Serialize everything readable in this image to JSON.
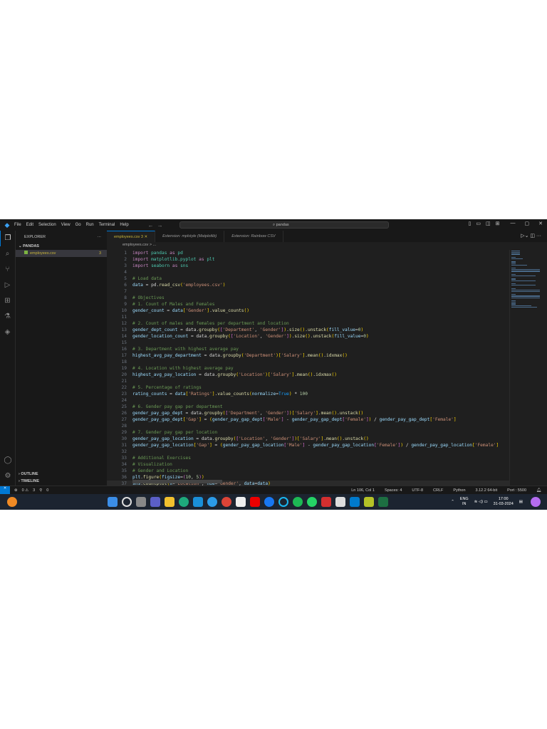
{
  "menu": [
    "File",
    "Edit",
    "Selection",
    "View",
    "Go",
    "Run",
    "Terminal",
    "Help"
  ],
  "search": "pandas",
  "sidebar": {
    "title": "EXPLORER",
    "folder": "PANDAS",
    "file": "employees.csv",
    "file_badge": "3",
    "outline": "OUTLINE",
    "timeline": "TIMELINE"
  },
  "tabs": [
    {
      "label": "employees.csv 3 ✕"
    },
    {
      "label": "Extension: mplstyle (Matplotlib)"
    },
    {
      "label": "Extension: Rainbow CSV"
    }
  ],
  "breadcrumb": "employees.csv > ...",
  "code": [
    [
      [
        "k",
        "import "
      ],
      [
        "m",
        "pandas"
      ],
      [
        "k",
        " as "
      ],
      [
        "m",
        "pd"
      ]
    ],
    [
      [
        "k",
        "import "
      ],
      [
        "m",
        "matplotlib.pyplot"
      ],
      [
        "k",
        " as "
      ],
      [
        "m",
        "plt"
      ]
    ],
    [
      [
        "k",
        "import "
      ],
      [
        "m",
        "seaborn"
      ],
      [
        "k",
        " as "
      ],
      [
        "m",
        "sns"
      ]
    ],
    [],
    [
      [
        "c",
        "# Load data"
      ]
    ],
    [
      [
        "v",
        "data"
      ],
      [
        "p",
        " = pd."
      ],
      [
        "f",
        "read_csv"
      ],
      [
        "b1",
        "("
      ],
      [
        "s",
        "'employees.csv'"
      ],
      [
        "b1",
        ")"
      ]
    ],
    [],
    [
      [
        "c",
        "# Objectives"
      ]
    ],
    [
      [
        "c",
        "# 1. Count of Males and Females"
      ]
    ],
    [
      [
        "v",
        "gender_count"
      ],
      [
        "p",
        " = "
      ],
      [
        "v",
        "data"
      ],
      [
        "b1",
        "["
      ],
      [
        "s",
        "'Gender'"
      ],
      [
        "b1",
        "]"
      ],
      [
        "p",
        "."
      ],
      [
        "f",
        "value_counts"
      ],
      [
        "b1",
        "()"
      ]
    ],
    [],
    [
      [
        "c",
        "# 2. Count of males and females per department and location"
      ]
    ],
    [
      [
        "v",
        "gender_dept_count"
      ],
      [
        "p",
        " = data."
      ],
      [
        "f",
        "groupby"
      ],
      [
        "b1",
        "("
      ],
      [
        "b2",
        "["
      ],
      [
        "s",
        "'Department'"
      ],
      [
        "p",
        ", "
      ],
      [
        "s",
        "'Gender'"
      ],
      [
        "b2",
        "]"
      ],
      [
        "b1",
        ")"
      ],
      [
        "p",
        "."
      ],
      [
        "f",
        "size"
      ],
      [
        "b1",
        "()"
      ],
      [
        "p",
        "."
      ],
      [
        "f",
        "unstack"
      ],
      [
        "b1",
        "("
      ],
      [
        "v",
        "fill_value"
      ],
      [
        "p",
        "="
      ],
      [
        "n",
        "0"
      ],
      [
        "b1",
        ")"
      ]
    ],
    [
      [
        "v",
        "gender_location_count"
      ],
      [
        "p",
        " = data."
      ],
      [
        "f",
        "groupby"
      ],
      [
        "b1",
        "("
      ],
      [
        "b2",
        "["
      ],
      [
        "s",
        "'Location'"
      ],
      [
        "p",
        ", "
      ],
      [
        "s",
        "'Gender'"
      ],
      [
        "b2",
        "]"
      ],
      [
        "b1",
        ")"
      ],
      [
        "p",
        "."
      ],
      [
        "f",
        "size"
      ],
      [
        "b1",
        "()"
      ],
      [
        "p",
        "."
      ],
      [
        "f",
        "unstack"
      ],
      [
        "b1",
        "("
      ],
      [
        "v",
        "fill_value"
      ],
      [
        "p",
        "="
      ],
      [
        "n",
        "0"
      ],
      [
        "b1",
        ")"
      ]
    ],
    [],
    [
      [
        "c",
        "# 3. Department with highest average pay"
      ]
    ],
    [
      [
        "v",
        "highest_avg_pay_department"
      ],
      [
        "p",
        " = data."
      ],
      [
        "f",
        "groupby"
      ],
      [
        "b1",
        "("
      ],
      [
        "s",
        "'Department'"
      ],
      [
        "b1",
        ")"
      ],
      [
        "b1",
        "["
      ],
      [
        "s",
        "'Salary'"
      ],
      [
        "b1",
        "]"
      ],
      [
        "p",
        "."
      ],
      [
        "f",
        "mean"
      ],
      [
        "b1",
        "()"
      ],
      [
        "p",
        "."
      ],
      [
        "f",
        "idxmax"
      ],
      [
        "b1",
        "()"
      ]
    ],
    [],
    [
      [
        "c",
        "# 4. Location with highest average pay"
      ]
    ],
    [
      [
        "v",
        "highest_avg_pay_location"
      ],
      [
        "p",
        " = data."
      ],
      [
        "f",
        "groupby"
      ],
      [
        "b1",
        "("
      ],
      [
        "s",
        "'Location'"
      ],
      [
        "b1",
        ")"
      ],
      [
        "b1",
        "["
      ],
      [
        "s",
        "'Salary'"
      ],
      [
        "b1",
        "]"
      ],
      [
        "p",
        "."
      ],
      [
        "f",
        "mean"
      ],
      [
        "b1",
        "()"
      ],
      [
        "p",
        "."
      ],
      [
        "f",
        "idxmax"
      ],
      [
        "b1",
        "()"
      ]
    ],
    [],
    [
      [
        "c",
        "# 5. Percentage of ratings"
      ]
    ],
    [
      [
        "v",
        "rating_counts"
      ],
      [
        "p",
        " = "
      ],
      [
        "v",
        "data"
      ],
      [
        "b1",
        "["
      ],
      [
        "s",
        "'Ratings'"
      ],
      [
        "b1",
        "]"
      ],
      [
        "p",
        "."
      ],
      [
        "f",
        "value_counts"
      ],
      [
        "b1",
        "("
      ],
      [
        "v",
        "normalize"
      ],
      [
        "p",
        "="
      ],
      [
        "b3",
        "True"
      ],
      [
        "b1",
        ")"
      ],
      [
        "p",
        " * "
      ],
      [
        "n",
        "100"
      ]
    ],
    [],
    [
      [
        "c",
        "# 6. Gender pay gap per department"
      ]
    ],
    [
      [
        "v",
        "gender_pay_gap_dept"
      ],
      [
        "p",
        " = data."
      ],
      [
        "f",
        "groupby"
      ],
      [
        "b1",
        "("
      ],
      [
        "b2",
        "["
      ],
      [
        "s",
        "'Department'"
      ],
      [
        "p",
        ", "
      ],
      [
        "s",
        "'Gender'"
      ],
      [
        "b2",
        "]"
      ],
      [
        "b1",
        ")"
      ],
      [
        "b1",
        "["
      ],
      [
        "s",
        "'Salary'"
      ],
      [
        "b1",
        "]"
      ],
      [
        "p",
        "."
      ],
      [
        "f",
        "mean"
      ],
      [
        "b1",
        "()"
      ],
      [
        "p",
        "."
      ],
      [
        "f",
        "unstack"
      ],
      [
        "b1",
        "()"
      ]
    ],
    [
      [
        "v",
        "gender_pay_gap_dept"
      ],
      [
        "b1",
        "["
      ],
      [
        "s",
        "'Gap'"
      ],
      [
        "b1",
        "]"
      ],
      [
        "p",
        " = "
      ],
      [
        "b1",
        "("
      ],
      [
        "v",
        "gender_pay_gap_dept"
      ],
      [
        "b2",
        "["
      ],
      [
        "s",
        "'Male'"
      ],
      [
        "b2",
        "]"
      ],
      [
        "p",
        " - "
      ],
      [
        "v",
        "gender_pay_gap_dept"
      ],
      [
        "b2",
        "["
      ],
      [
        "s",
        "'Female'"
      ],
      [
        "b2",
        "]"
      ],
      [
        "b1",
        ")"
      ],
      [
        "p",
        " / "
      ],
      [
        "v",
        "gender_pay_gap_dept"
      ],
      [
        "b1",
        "["
      ],
      [
        "s",
        "'Female'"
      ],
      [
        "b1",
        "]"
      ]
    ],
    [],
    [
      [
        "c",
        "# 7. Gender pay gap per location"
      ]
    ],
    [
      [
        "v",
        "gender_pay_gap_location"
      ],
      [
        "p",
        " = data."
      ],
      [
        "f",
        "groupby"
      ],
      [
        "b1",
        "("
      ],
      [
        "b2",
        "["
      ],
      [
        "s",
        "'Location'"
      ],
      [
        "p",
        ", "
      ],
      [
        "s",
        "'Gender'"
      ],
      [
        "b2",
        "]"
      ],
      [
        "b1",
        ")"
      ],
      [
        "b1",
        "["
      ],
      [
        "s",
        "'Salary'"
      ],
      [
        "b1",
        "]"
      ],
      [
        "p",
        "."
      ],
      [
        "f",
        "mean"
      ],
      [
        "b1",
        "()"
      ],
      [
        "p",
        "."
      ],
      [
        "f",
        "unstack"
      ],
      [
        "b1",
        "()"
      ]
    ],
    [
      [
        "v",
        "gender_pay_gap_location"
      ],
      [
        "b1",
        "["
      ],
      [
        "s",
        "'Gap'"
      ],
      [
        "b1",
        "]"
      ],
      [
        "p",
        " = "
      ],
      [
        "b1",
        "("
      ],
      [
        "v",
        "gender_pay_gap_location"
      ],
      [
        "b2",
        "["
      ],
      [
        "s",
        "'Male'"
      ],
      [
        "b2",
        "]"
      ],
      [
        "p",
        " - "
      ],
      [
        "v",
        "gender_pay_gap_location"
      ],
      [
        "b2",
        "["
      ],
      [
        "s",
        "'Female'"
      ],
      [
        "b2",
        "]"
      ],
      [
        "b1",
        ")"
      ],
      [
        "p",
        " / "
      ],
      [
        "v",
        "gender_pay_gap_location"
      ],
      [
        "b1",
        "["
      ],
      [
        "s",
        "'Female'"
      ],
      [
        "b1",
        "]"
      ]
    ],
    [],
    [
      [
        "c",
        "# Additional Exercises"
      ]
    ],
    [
      [
        "c",
        "# Visualization"
      ]
    ],
    [
      [
        "c",
        "# Gender and Location"
      ]
    ],
    [
      [
        "v",
        "plt"
      ],
      [
        "p",
        "."
      ],
      [
        "f",
        "figure"
      ],
      [
        "b1",
        "("
      ],
      [
        "v",
        "figsize"
      ],
      [
        "p",
        "="
      ],
      [
        "b2",
        "("
      ],
      [
        "n",
        "10"
      ],
      [
        "p",
        ", "
      ],
      [
        "n",
        "5"
      ],
      [
        "b2",
        ")"
      ],
      [
        "b1",
        ")"
      ]
    ],
    [
      [
        "v",
        "sns"
      ],
      [
        "p",
        "."
      ],
      [
        "f",
        "countplot"
      ],
      [
        "b1",
        "("
      ],
      [
        "v",
        "x"
      ],
      [
        "p",
        "="
      ],
      [
        "s",
        "'Location'"
      ],
      [
        "p",
        ", "
      ],
      [
        "v",
        "hue"
      ],
      [
        "p",
        "="
      ],
      [
        "s",
        "'Gender'"
      ],
      [
        "p",
        ", "
      ],
      [
        "v",
        "data"
      ],
      [
        "p",
        "="
      ],
      [
        "v",
        "data"
      ],
      [
        "b1",
        ")"
      ]
    ]
  ],
  "status": {
    "errors": "0",
    "warnings": "3",
    "ports": "0",
    "position": "Ln 106, Col 1",
    "spaces": "Spaces: 4",
    "encoding": "UTF-8",
    "eol": "CRLF",
    "language": "Python",
    "interpreter": "3.12.2 64-bit",
    "port": "Port : 5500"
  },
  "taskbar": {
    "lang": "ENG",
    "region": "IN",
    "time": "17:00",
    "date": "31-03-2024"
  }
}
